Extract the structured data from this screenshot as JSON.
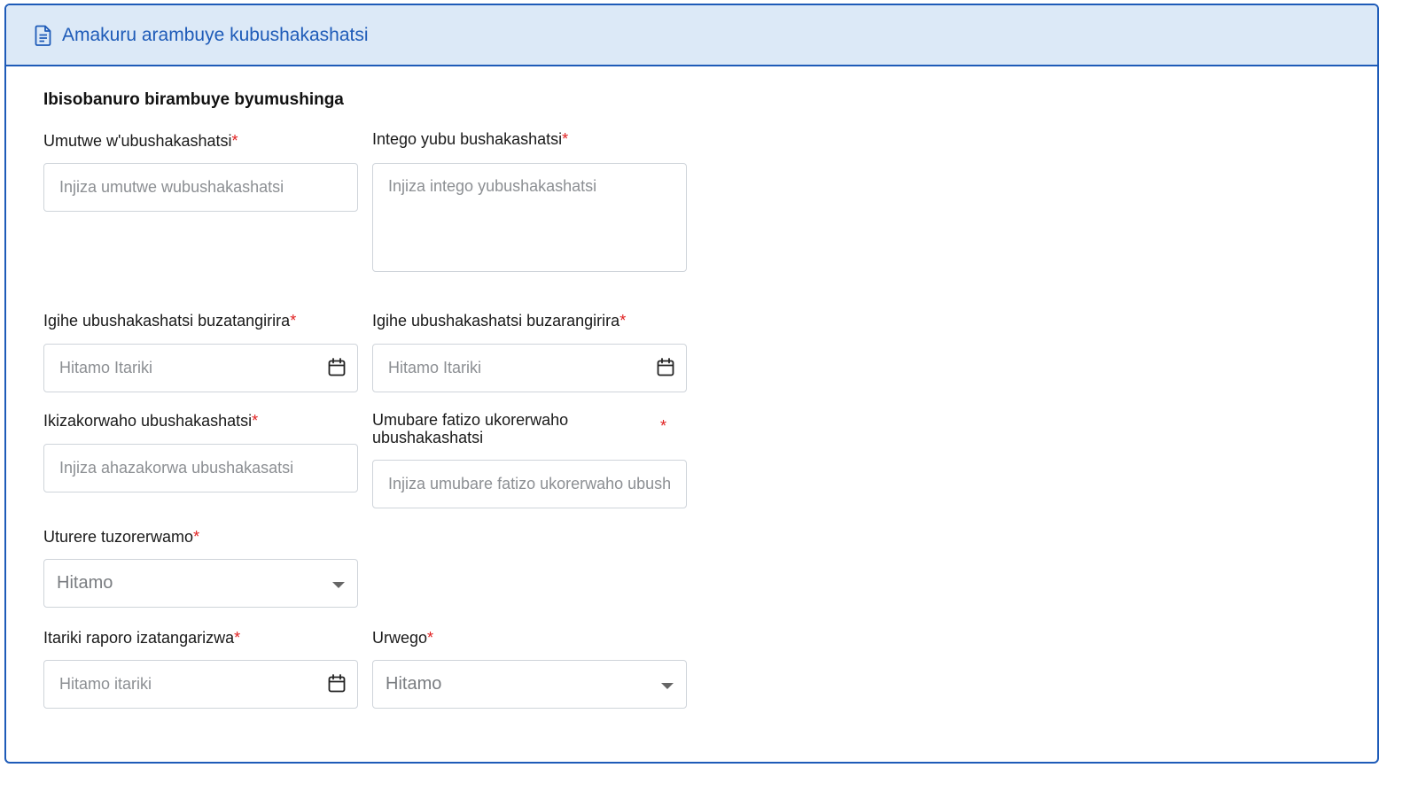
{
  "header": {
    "title": "Amakuru arambuye kubushakashatsi",
    "icon": "document-icon"
  },
  "section": {
    "title": "Ibisobanuro birambuye byumushinga"
  },
  "required_marker": "*",
  "fields": {
    "title": {
      "label": "Umutwe w'ubushakashatsi",
      "placeholder": "Injiza umutwe wubushakashatsi",
      "value": ""
    },
    "objective": {
      "label": "Intego yubu bushakashatsi",
      "placeholder": "Injiza intego yubushakashatsi",
      "value": ""
    },
    "start_date": {
      "label": "Igihe ubushakashatsi buzatangirira",
      "placeholder": "Hitamo Itariki",
      "value": "",
      "icon": "calendar-icon"
    },
    "end_date": {
      "label": "Igihe ubushakashatsi buzarangirira",
      "placeholder": "Hitamo Itariki",
      "value": "",
      "icon": "calendar-icon"
    },
    "location": {
      "label": "Ikizakorwaho ubushakashatsi",
      "placeholder": "Injiza ahazakorwa ubushakasatsi",
      "value": ""
    },
    "reference_number": {
      "label_line1": "Umubare fatizo ukorerwaho",
      "label_line2": "ubushakashatsi",
      "placeholder": "Injiza umubare fatizo ukorerwaho ubushakashatsi",
      "value": ""
    },
    "district": {
      "label": "Uturere tuzorerwamo",
      "selected": "Hitamo"
    },
    "report_date": {
      "label": "Itariki raporo izatangarizwa",
      "placeholder": "Hitamo itariki",
      "value": "",
      "icon": "calendar-icon"
    },
    "level": {
      "label": "Urwego",
      "selected": "Hitamo"
    }
  },
  "colors": {
    "accent": "#1e5bb8",
    "header_bg": "#dce9f7",
    "required": "#e02020",
    "border": "#cfd4da"
  }
}
